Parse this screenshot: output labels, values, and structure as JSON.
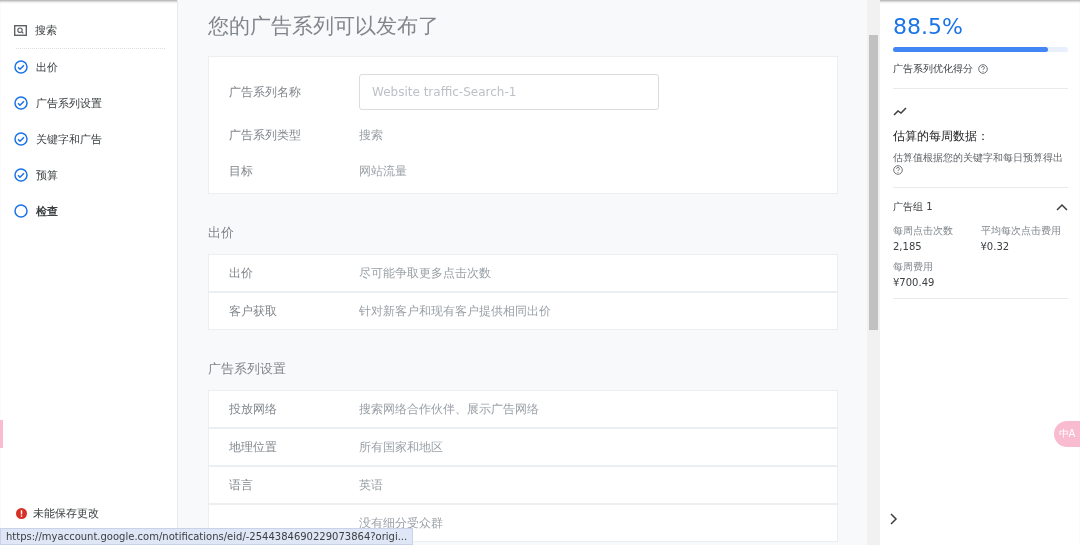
{
  "sidebar": {
    "search": {
      "label": "搜索"
    },
    "items": [
      {
        "label": "出价",
        "done": true,
        "selected": false
      },
      {
        "label": "广告系列设置",
        "done": true,
        "selected": false
      },
      {
        "label": "关键字和广告",
        "done": true,
        "selected": false
      },
      {
        "label": "预算",
        "done": true,
        "selected": false
      },
      {
        "label": "检查",
        "done": false,
        "selected": true
      }
    ],
    "error": "未能保存更改"
  },
  "main": {
    "title": "您的广告系列可以发布了",
    "summary": {
      "name_label": "广告系列名称",
      "name_value": "Website traffic-Search-1",
      "rows": [
        {
          "label": "广告系列类型",
          "value": "搜索"
        },
        {
          "label": "目标",
          "value": "网站流量"
        }
      ]
    },
    "sections": [
      {
        "title": "出价",
        "rows": [
          {
            "label": "出价",
            "value": "尽可能争取更多点击次数"
          },
          {
            "label": "客户获取",
            "value": "针对新客户和现有客户提供相同出价"
          }
        ]
      },
      {
        "title": "广告系列设置",
        "rows": [
          {
            "label": "投放网络",
            "value": "搜索网络合作伙伴、展示广告网络"
          },
          {
            "label": "地理位置",
            "value": "所有国家和地区"
          },
          {
            "label": "语言",
            "value": "英语"
          },
          {
            "label": "",
            "value": "没有细分受众群"
          }
        ]
      }
    ]
  },
  "score_panel": {
    "score": "88.5%",
    "level": 0.885,
    "score_label": "广告系列优化得分",
    "weekly_title": "估算的每周数据：",
    "weekly_note": "估算值根据您的关键字和每日预算得出",
    "ad_group": {
      "title": "广告组 1",
      "expanded": true,
      "stats": [
        {
          "label": "每周点击次数",
          "value": "2,185"
        },
        {
          "label": "平均每次点击费用",
          "value": "¥0.32"
        },
        {
          "label": "每周费用",
          "value": "¥700.49"
        }
      ]
    }
  },
  "translate_button": {
    "label": "中A"
  },
  "status_bar": {
    "url": "https://myaccount.google.com/notifications/eid/-2544384690229073864?origi..."
  }
}
